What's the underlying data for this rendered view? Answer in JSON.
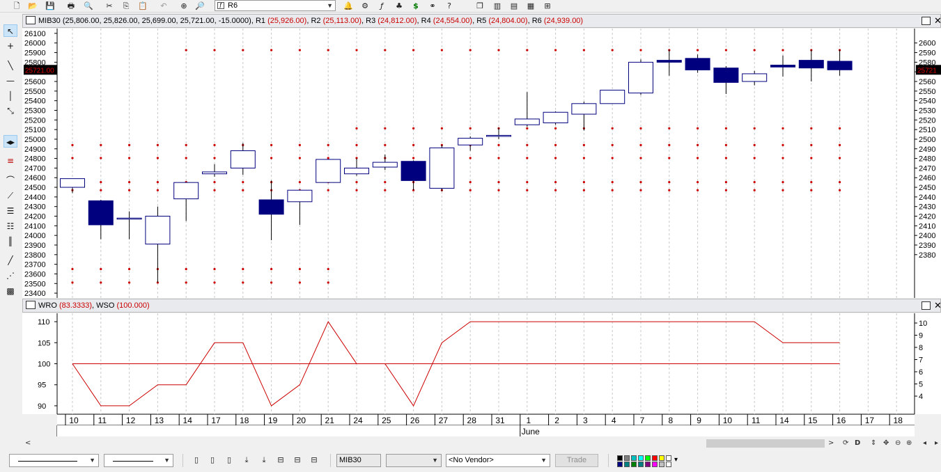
{
  "toolbar": {
    "instrument_combo": "R6",
    "icons": [
      "new-document-icon",
      "open-folder-icon",
      "save-icon",
      "print-icon",
      "print-preview-icon",
      "cut-icon",
      "copy-icon",
      "paste-icon",
      "undo-icon",
      "crosshair-icon",
      "zoom-icon",
      "alert-icon",
      "scanner-icon",
      "function-icon",
      "tree-icon",
      "dollar-icon",
      "binoculars-icon",
      "help-icon",
      "window-list-icon",
      "tile-vertical-icon",
      "tile-horizontal-icon",
      "tile-grid-icon",
      "layout-icon"
    ]
  },
  "left_tools": [
    "pointer-tool",
    "crosshair-tool",
    "trendline-tool",
    "horizontal-line-tool",
    "vertical-line-tool",
    "zoom-tool",
    "scroll-tool",
    "indicator-tool",
    "arc-tool",
    "fan-tool",
    "fib-retracement-tool",
    "fib-extension-tool",
    "cycle-lines-tool",
    "line-tool",
    "speed-lines-tool",
    "gann-grid-tool"
  ],
  "price_pane": {
    "symbol": "MIB30",
    "ohlc": "(25,806.00, 25,826.00, 25,699.00, 25,721.00, -15.0000)",
    "pivots": [
      {
        "label": "R1",
        "value": "(25,926.00)"
      },
      {
        "label": "R2",
        "value": "(25,113.00)"
      },
      {
        "label": "R3",
        "value": "(24,812.00)"
      },
      {
        "label": "R4",
        "value": "(24,554.00)"
      },
      {
        "label": "R5",
        "value": "(24,804.00)"
      },
      {
        "label": "R6",
        "value": "(24,939.00)"
      }
    ],
    "last_price_tag": "25721.00",
    "right_last_tag": "25721",
    "left_axis_labels": [
      "26100",
      "26000",
      "25900",
      "25800",
      "25700",
      "25600",
      "25500",
      "25400",
      "25300",
      "25200",
      "25100",
      "25000",
      "24900",
      "24800",
      "24700",
      "24600",
      "24500",
      "24400",
      "24300",
      "24200",
      "24100",
      "24000",
      "23900",
      "23800",
      "23700",
      "23600",
      "23500",
      "23400"
    ],
    "right_axis_labels": [
      "2600",
      "2590",
      "2580",
      "2570",
      "2560",
      "2550",
      "2540",
      "2530",
      "2520",
      "2510",
      "2500",
      "2490",
      "2480",
      "2470",
      "2460",
      "2450",
      "2440",
      "2430",
      "2420",
      "2410",
      "2400",
      "2390",
      "2380"
    ]
  },
  "indicator_pane": {
    "title_a": "WRO",
    "value_a": "(83.3333)",
    "title_b": "WSO",
    "value_b": "(100.000)",
    "left_axis_labels": [
      "110",
      "105",
      "100",
      "95",
      "90"
    ],
    "right_axis_labels": [
      "10",
      "9",
      "8",
      "7",
      "6",
      "5",
      "4"
    ]
  },
  "date_axis": {
    "days": [
      "10",
      "11",
      "12",
      "13",
      "14",
      "17",
      "18",
      "19",
      "20",
      "21",
      "24",
      "25",
      "26",
      "27",
      "28",
      "31",
      "1",
      "2",
      "3",
      "4",
      "7",
      "8",
      "9",
      "10",
      "11",
      "14",
      "15",
      "16",
      "17",
      "18"
    ],
    "month_label": "June"
  },
  "chart_data": [
    {
      "type": "candlestick",
      "series_name": "MIB30",
      "x": [
        "10",
        "11",
        "12",
        "13",
        "14",
        "17",
        "18",
        "19",
        "20",
        "21",
        "24",
        "25",
        "26",
        "27",
        "28",
        "31",
        "1",
        "2",
        "3",
        "4",
        "7",
        "8",
        "9",
        "10",
        "11",
        "14",
        "15",
        "16"
      ],
      "open": [
        24500,
        24360,
        24170,
        23910,
        24380,
        24640,
        24700,
        24370,
        24350,
        24550,
        24640,
        24710,
        24770,
        24490,
        24940,
        25030,
        25150,
        25170,
        25260,
        25370,
        25480,
        25820,
        25840,
        25740,
        25600,
        25770,
        25820,
        25810
      ],
      "high": [
        24590,
        24370,
        24250,
        24300,
        24550,
        24740,
        24960,
        24570,
        24470,
        24790,
        24800,
        24840,
        24780,
        24940,
        25030,
        25120,
        25490,
        25290,
        25390,
        25490,
        25830,
        25930,
        25880,
        25760,
        25710,
        25870,
        25930,
        25930
      ],
      "low": [
        24440,
        23960,
        23960,
        23510,
        24150,
        24610,
        24630,
        23950,
        24110,
        24550,
        24620,
        24680,
        24470,
        24460,
        24880,
        25000,
        25130,
        25150,
        25090,
        25370,
        25460,
        25660,
        25690,
        25470,
        25560,
        25650,
        25600,
        25660
      ],
      "close": [
        24590,
        24110,
        24180,
        24200,
        24550,
        24660,
        24880,
        24220,
        24470,
        24790,
        24700,
        24760,
        24570,
        24910,
        25010,
        25040,
        25210,
        25280,
        25370,
        25510,
        25800,
        25800,
        25720,
        25590,
        25680,
        25750,
        25740,
        25721
      ],
      "pivot_dots": [
        {
          "from": "10",
          "to": "21",
          "levels": [
            24939,
            24804,
            24554,
            24470,
            23650,
            23510
          ]
        },
        {
          "from": "24",
          "to": "16",
          "levels": [
            25113,
            24939,
            24804,
            24554,
            24470
          ]
        },
        {
          "from": "14",
          "to": "16",
          "levels": [
            25926
          ]
        }
      ],
      "ylim": [
        23350,
        26150
      ]
    },
    {
      "type": "line",
      "x": [
        "10",
        "11",
        "12",
        "13",
        "14",
        "17",
        "18",
        "19",
        "20",
        "21",
        "24",
        "25",
        "26",
        "27",
        "28",
        "31",
        "1",
        "2",
        "3",
        "4",
        "7",
        "8",
        "9",
        "10",
        "11",
        "14",
        "15",
        "16"
      ],
      "series": [
        {
          "name": "WRO",
          "color": "#cc0000",
          "values": [
            100,
            90,
            90,
            95,
            95,
            105,
            105,
            90,
            95,
            110,
            100,
            100,
            90,
            105,
            110,
            110,
            110,
            110,
            110,
            110,
            110,
            110,
            110,
            110,
            110,
            105,
            105,
            105
          ]
        },
        {
          "name": "WSO",
          "color": "#cc0000",
          "values": [
            100,
            100,
            100,
            100,
            100,
            100,
            100,
            100,
            100,
            100,
            100,
            100,
            100,
            100,
            100,
            100,
            100,
            100,
            100,
            100,
            100,
            100,
            100,
            100,
            100,
            100,
            100,
            100
          ]
        }
      ],
      "ylim": [
        88,
        112
      ]
    }
  ],
  "bottom": {
    "symbol_field": "MIB30",
    "vendor": "<No Vendor>",
    "trade_button": "Trade",
    "nav_buttons": [
      "refresh",
      "D",
      "scroll-up-down",
      "pan",
      "zoom-out",
      "zoom-in"
    ],
    "palette_colors": [
      "#000000",
      "#808080",
      "#00c0c0",
      "#00ffff",
      "#00ff00",
      "#ff0000",
      "#ffff00",
      "#ffffff",
      "#000080",
      "#008080",
      "#008000",
      "#008080",
      "#800080",
      "#ff00ff",
      "#c0c0c0",
      "#ffffff"
    ]
  },
  "colors": {
    "bear_body": "#00007f",
    "bull_body": "#ffffff",
    "candle_edge": "#00007f",
    "pivot_dot": "#cc0000",
    "indicator_line": "#cc0000"
  }
}
